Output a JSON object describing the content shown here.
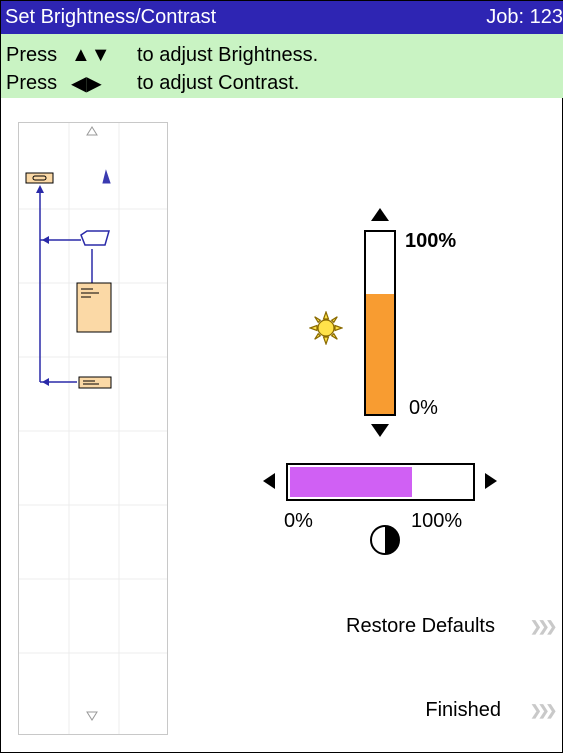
{
  "header": {
    "title": "Set Brightness/Contrast",
    "job": "Job:  123"
  },
  "instructions": {
    "line1": {
      "press": "Press",
      "arrows": "▲▼",
      "text": "to adjust Brightness."
    },
    "line2": {
      "press": "Press",
      "arrows": "◀▶",
      "text": "to adjust Contrast."
    }
  },
  "brightness": {
    "level_fraction": 0.66,
    "max_label": "100%",
    "min_label": "0%",
    "icon": "sun-icon",
    "fill_color": "#f89c31"
  },
  "contrast": {
    "level_fraction": 0.68,
    "min_label": "0%",
    "max_label": "100%",
    "icon": "contrast-icon",
    "fill_color": "#d060f4"
  },
  "actions": {
    "restore_label": "Restore Defaults",
    "finished_label": "Finished"
  },
  "colors": {
    "title_bg": "#2e25b3",
    "instruction_bg": "#c9f3c3",
    "flow_line": "#2a2aa8",
    "paper": "#fbd9a6"
  }
}
